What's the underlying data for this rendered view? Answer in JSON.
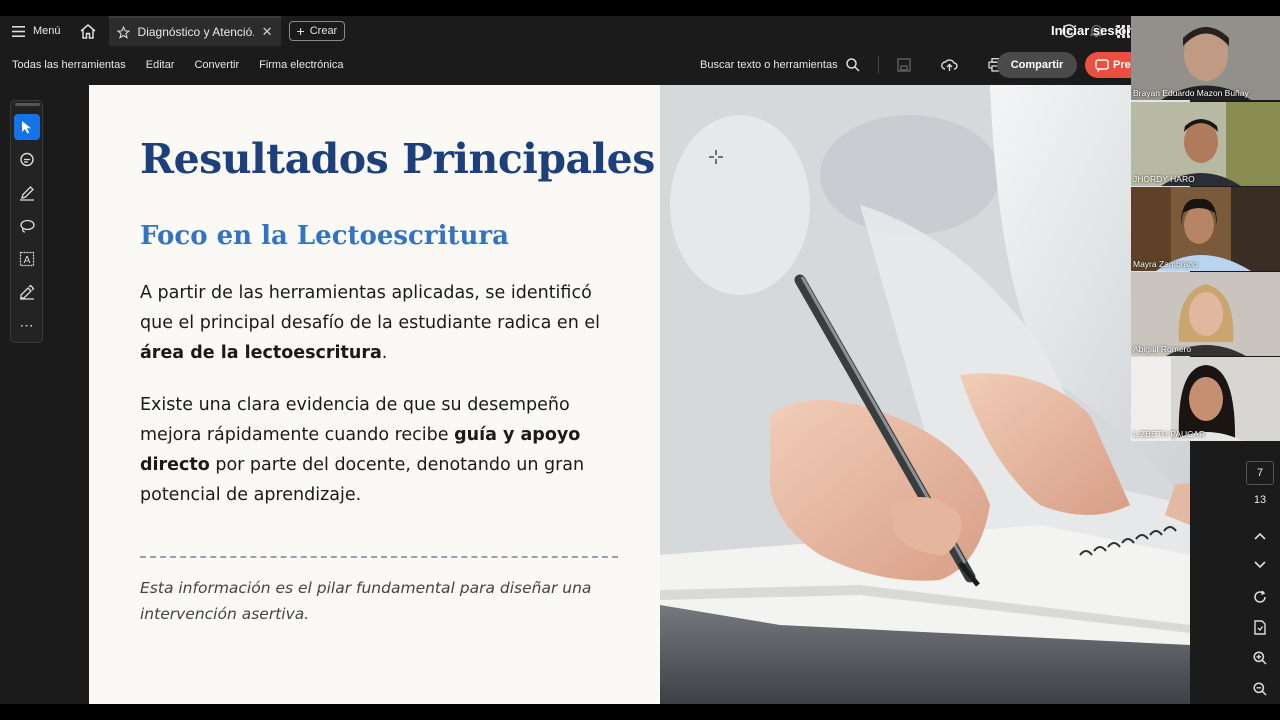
{
  "header": {
    "menu_label": "Menú",
    "tab_title": "Diagnóstico y Atenció...",
    "create_label": "Crear",
    "signin_label": "Iniciar sesión"
  },
  "toolbar": {
    "items": [
      "Todas las herramientas",
      "Editar",
      "Convertir",
      "Firma electrónica"
    ],
    "search_label": "Buscar texto o herramientas",
    "share_label": "Compartir",
    "present_label": "Pre"
  },
  "slide": {
    "title": "Resultados Principales",
    "subtitle": "Foco en la Lectoescritura",
    "para1_a": "A partir de las herramientas aplicadas, se identificó que el principal desafío de la estudiante radica en el ",
    "para1_b": "área de la lectoescritura",
    "para1_c": ".",
    "para2_a": "Existe una clara evidencia de que su desempeño mejora rápidamente cuando recibe ",
    "para2_b": "guía y apoyo directo",
    "para2_c": " por parte del docente, denotando un gran potencial de aprendizaje.",
    "note": "Esta información es el pilar fundamental para diseñar una intervención asertiva."
  },
  "participants": [
    {
      "name": "Brayan Eduardo Mazon Buñay",
      "bg": "#6d6a66"
    },
    {
      "name": "JHORDY HARO",
      "bg": "#b8b9a3"
    },
    {
      "name": "Mayra Zambrano",
      "bg": "#7b5a3c"
    },
    {
      "name": "Abigail Romero",
      "bg": "#c9c4be"
    },
    {
      "name": "LIZBETH PAUCAR",
      "bg": "#d8d6d2"
    }
  ],
  "pager": {
    "current": "7",
    "total": "13"
  },
  "colors": {
    "title": "#1d3f7a",
    "subtitle": "#3473c4",
    "accent_active": "#1473e6",
    "present": "#e9503f"
  }
}
